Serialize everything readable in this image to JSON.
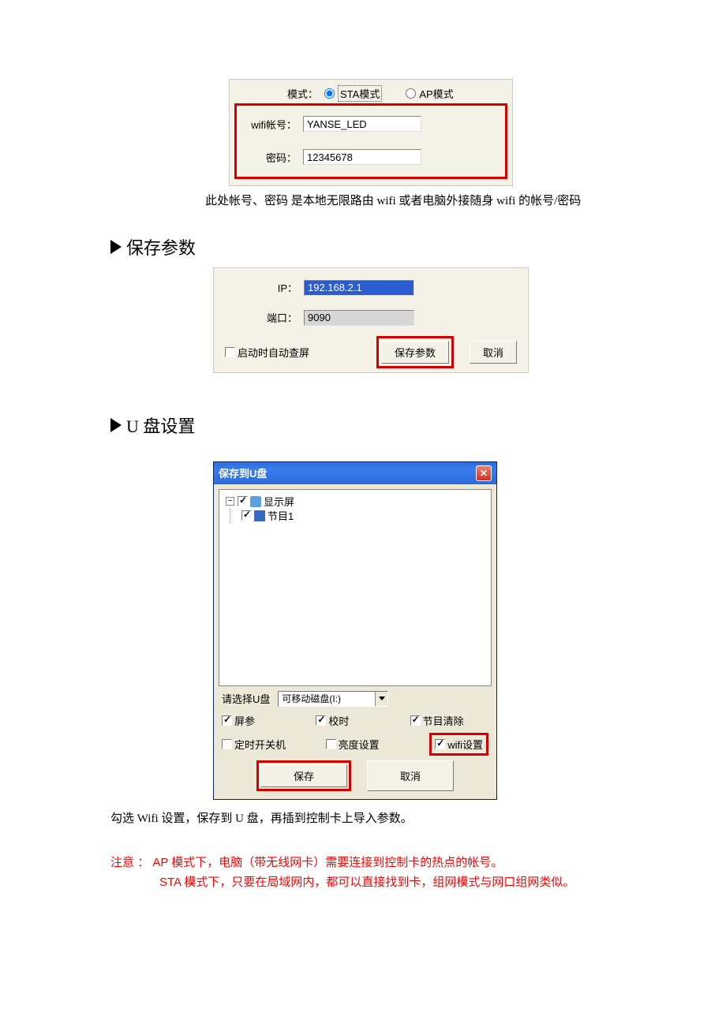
{
  "panel1": {
    "mode_label": "模式：",
    "sta_label": "STA模式",
    "ap_label": "AP模式",
    "wifi_label": "wifi帐号：",
    "wifi_value": "YANSE_LED",
    "pwd_label": "密码：",
    "pwd_value": "12345678"
  },
  "caption1": "此处帐号、密码 是本地无限路由 wifi 或者电脑外接随身 wifi 的帐号/密码",
  "heading_save": "保存参数",
  "panel2": {
    "ip_label": "IP：",
    "ip_value": "192.168.2.1",
    "port_label": "端口：",
    "port_value": "9090",
    "auto_label": "启动时自动查屏",
    "save_btn": "保存参数",
    "cancel_btn": "取消"
  },
  "heading_usb": "U 盘设置",
  "usb": {
    "title": "保存到U盘",
    "tree_root": "显示屏",
    "tree_child": "节目1",
    "select_label": "请选择U盘",
    "disk_value": "可移动磁盘(I:)",
    "c1": "屏参",
    "c2": "校时",
    "c3": "节目清除",
    "c4": "定时开关机",
    "c5": "亮度设置",
    "c6": "wifi设置",
    "save_btn": "保存",
    "cancel_btn": "取消"
  },
  "caption2": "勾选 Wifi 设置，保存到 U 盘，再插到控制卡上导入参数。",
  "note_prefix": "注意 ：",
  "note_line1": " AP 模式下，电脑（带无线网卡）需要连接到控制卡的热点的帐号。",
  "note_line2": "STA 模式下，只要在局域网内，都可以直接找到卡，组网模式与网口组网类似。"
}
